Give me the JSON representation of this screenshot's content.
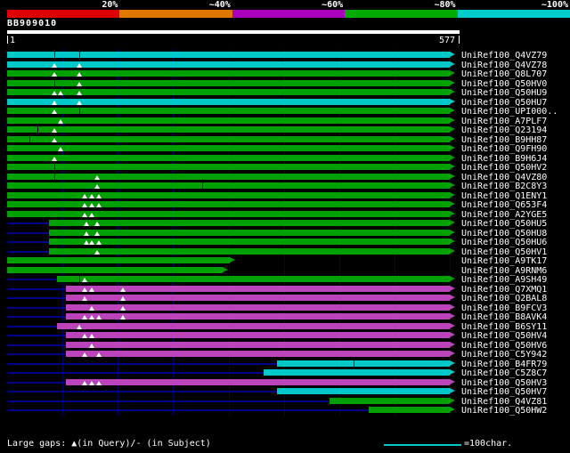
{
  "header": {
    "query_name": "BB909010"
  },
  "scale_bar": {
    "segments": [
      {
        "label": "20%",
        "color": "#dd0000"
      },
      {
        "label": "~40%",
        "color": "#dd7700"
      },
      {
        "label": "~60%",
        "color": "#aa00bb"
      },
      {
        "label": "~80%",
        "color": "#00aa00"
      },
      {
        "label": "~100%",
        "color": "#00cccc"
      }
    ]
  },
  "ruler": {
    "start": "1",
    "end": "577"
  },
  "legend": {
    "gap_note": "Large gaps: ▲(in Query)/- (in Subject)",
    "scale_label": "=100char."
  },
  "colors": {
    "green": "#00a000",
    "cyan": "#00c8c8",
    "magenta": "#bb44bb",
    "baseline": "#000088"
  },
  "chart_data": {
    "type": "bar",
    "orientation": "horizontal",
    "title": "BB909010",
    "x_range": [
      1,
      577
    ],
    "xlabel": "query position",
    "legend_position": "top",
    "rows": [
      {
        "label": "UniRef100_Q4VZ79",
        "color": "cyan",
        "bar": [
          1,
          577
        ],
        "gq": [],
        "gs": [
          63,
          95
        ]
      },
      {
        "label": "UniRef100_Q4VZ78",
        "color": "cyan",
        "bar": [
          1,
          577
        ],
        "gq": [
          63,
          95
        ],
        "gs": []
      },
      {
        "label": "UniRef100_Q8L707",
        "color": "green",
        "bar": [
          1,
          577
        ],
        "gq": [
          63,
          95
        ],
        "gs": []
      },
      {
        "label": "UniRef100_Q50HV0",
        "color": "green",
        "bar": [
          1,
          577
        ],
        "gq": [
          95
        ],
        "gs": [
          63
        ]
      },
      {
        "label": "UniRef100_Q50HU9",
        "color": "green",
        "bar": [
          1,
          577
        ],
        "gq": [
          63,
          70,
          95
        ],
        "gs": []
      },
      {
        "label": "UniRef100_Q50HU7",
        "color": "cyan",
        "bar": [
          1,
          577
        ],
        "gq": [
          63,
          95
        ],
        "gs": []
      },
      {
        "label": "UniRef100_UPI000..",
        "color": "green",
        "bar": [
          1,
          577
        ],
        "gq": [
          63
        ],
        "gs": [
          95
        ]
      },
      {
        "label": "UniRef100_A7PLF7",
        "color": "green",
        "bar": [
          1,
          577
        ],
        "gq": [
          70
        ],
        "gs": []
      },
      {
        "label": "UniRef100_Q23194",
        "color": "green",
        "bar": [
          1,
          577
        ],
        "gq": [
          63
        ],
        "gs": [
          40
        ]
      },
      {
        "label": "UniRef100_B9HH87",
        "color": "green",
        "bar": [
          1,
          577
        ],
        "gq": [
          63
        ],
        "gs": [
          30
        ]
      },
      {
        "label": "UniRef100_Q9FH90",
        "color": "green",
        "bar": [
          1,
          577
        ],
        "gq": [
          70
        ],
        "gs": []
      },
      {
        "label": "UniRef100_B9H6J4",
        "color": "green",
        "bar": [
          1,
          577
        ],
        "gq": [
          63
        ],
        "gs": []
      },
      {
        "label": "UniRef100_Q50HV2",
        "color": "green",
        "bar": [
          1,
          577
        ],
        "gq": [],
        "gs": [
          63
        ]
      },
      {
        "label": "UniRef100_Q4VZ80",
        "color": "green",
        "bar": [
          1,
          577
        ],
        "gq": [
          118
        ],
        "gs": [
          63
        ]
      },
      {
        "label": "UniRef100_B2C8Y3",
        "color": "green",
        "bar": [
          1,
          577
        ],
        "gq": [
          118
        ],
        "gs": [
          255
        ]
      },
      {
        "label": "UniRef100_Q1ENY1",
        "color": "green",
        "bar": [
          1,
          577
        ],
        "gq": [
          102,
          111,
          120
        ],
        "gs": []
      },
      {
        "label": "UniRef100_Q653F4",
        "color": "green",
        "bar": [
          1,
          577
        ],
        "gq": [
          102,
          111,
          120
        ],
        "gs": []
      },
      {
        "label": "UniRef100_A2YGE5",
        "color": "green",
        "bar": [
          1,
          577
        ],
        "gq": [
          102,
          111
        ],
        "gs": []
      },
      {
        "label": "UniRef100_Q50HU5",
        "color": "green",
        "bar": [
          55,
          577
        ],
        "gq": [
          104,
          118
        ],
        "gs": []
      },
      {
        "label": "UniRef100_Q50HU8",
        "color": "green",
        "bar": [
          55,
          577
        ],
        "gq": [
          104,
          118
        ],
        "gs": []
      },
      {
        "label": "UniRef100_Q50HU6",
        "color": "green",
        "bar": [
          55,
          577
        ],
        "gq": [
          104,
          111,
          120
        ],
        "gs": []
      },
      {
        "label": "UniRef100_Q50HV1",
        "color": "green",
        "bar": [
          55,
          577
        ],
        "gq": [
          118
        ],
        "gs": []
      },
      {
        "label": "UniRef100_A9TK17",
        "color": "green",
        "bar": [
          1,
          291
        ],
        "line": [
          1,
          291
        ],
        "gq": [],
        "gs": []
      },
      {
        "label": "UniRef100_A9RNM6",
        "color": "green",
        "bar": [
          1,
          281
        ],
        "line": [
          1,
          281
        ],
        "gq": [],
        "gs": []
      },
      {
        "label": "UniRef100_A9SH49",
        "color": "green",
        "bar": [
          66,
          577
        ],
        "gq": [
          102
        ],
        "gs": [
          95
        ]
      },
      {
        "label": "UniRef100_Q7XMQ1",
        "color": "magenta",
        "bar": [
          78,
          577
        ],
        "gq": [
          102,
          111,
          152
        ],
        "gs": []
      },
      {
        "label": "UniRef100_Q2BAL8",
        "color": "magenta",
        "bar": [
          78,
          577
        ],
        "gq": [
          102,
          152
        ],
        "gs": []
      },
      {
        "label": "UniRef100_B9FCV3",
        "color": "magenta",
        "bar": [
          78,
          577
        ],
        "gq": [
          111,
          152
        ],
        "gs": []
      },
      {
        "label": "UniRef100_B8AVK4",
        "color": "magenta",
        "bar": [
          78,
          577
        ],
        "gq": [
          102,
          111,
          120,
          152
        ],
        "gs": []
      },
      {
        "label": "UniRef100_B6SY11",
        "color": "magenta",
        "bar": [
          66,
          577
        ],
        "gq": [
          95
        ],
        "gs": []
      },
      {
        "label": "UniRef100_Q50HV4",
        "color": "magenta",
        "bar": [
          78,
          577
        ],
        "gq": [
          102,
          111
        ],
        "gs": []
      },
      {
        "label": "UniRef100_Q50HV6",
        "color": "magenta",
        "bar": [
          78,
          577
        ],
        "gq": [
          111
        ],
        "gs": []
      },
      {
        "label": "UniRef100_C5Y942",
        "color": "magenta",
        "bar": [
          78,
          577
        ],
        "gq": [
          102,
          120
        ],
        "gs": []
      },
      {
        "label": "UniRef100_B4FR79",
        "color": "cyan",
        "bar": [
          352,
          577
        ],
        "gq": [],
        "gs": [
          452
        ]
      },
      {
        "label": "UniRef100_C5Z8C7",
        "color": "cyan",
        "bar": [
          335,
          577
        ],
        "gq": [],
        "gs": []
      },
      {
        "label": "UniRef100_Q50HV3",
        "color": "magenta",
        "bar": [
          78,
          577
        ],
        "gq": [
          102,
          111,
          120
        ],
        "gs": []
      },
      {
        "label": "UniRef100_Q50HV7",
        "color": "cyan",
        "bar": [
          352,
          577
        ],
        "gq": [],
        "gs": []
      },
      {
        "label": "UniRef100_Q4VZ81",
        "color": "green",
        "bar": [
          420,
          577
        ],
        "gq": [],
        "gs": []
      },
      {
        "label": "UniRef100_Q50HW2",
        "color": "green",
        "bar": [
          472,
          577
        ],
        "gq": [],
        "gs": []
      }
    ]
  }
}
